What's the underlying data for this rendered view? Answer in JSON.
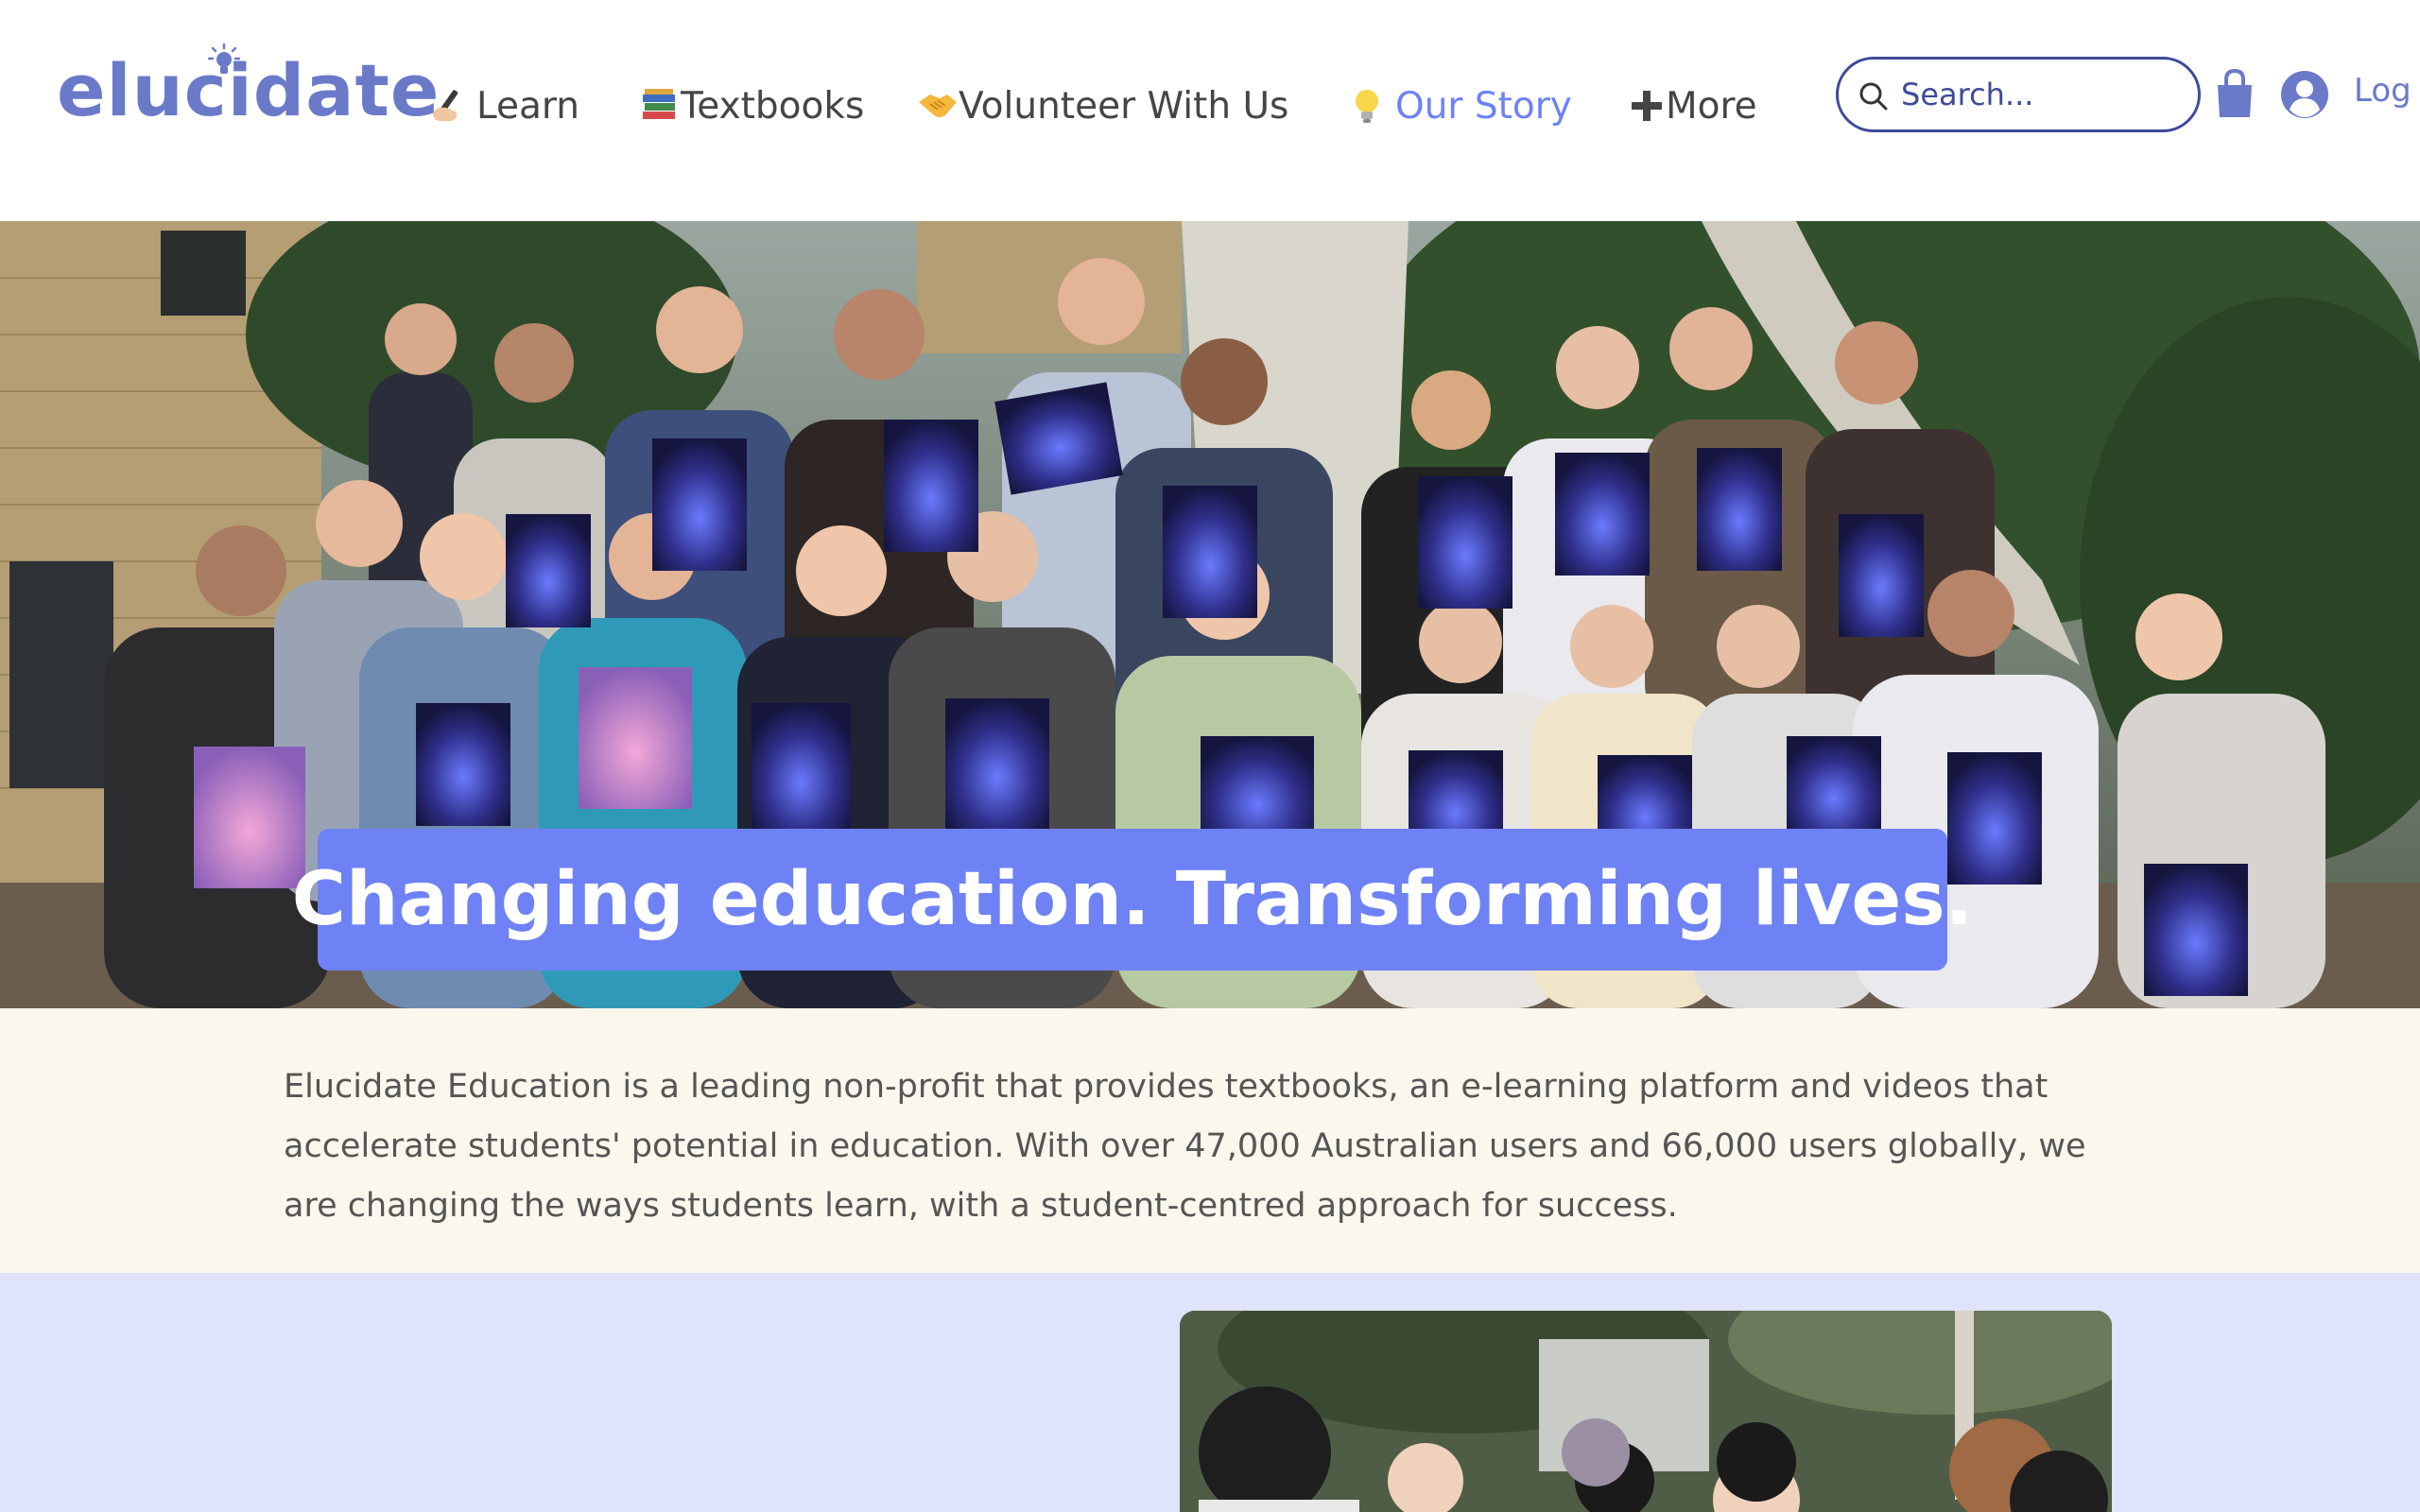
{
  "brand": {
    "name": "elucidate",
    "color": "#6b79c9",
    "accent": "#6e82f5"
  },
  "nav": {
    "items": [
      {
        "label": "Learn",
        "icon": "writing-hand-icon"
      },
      {
        "label": "Textbooks",
        "icon": "books-icon"
      },
      {
        "label": "Volunteer With Us",
        "icon": "handshake-icon"
      },
      {
        "label": "Our Story",
        "icon": "lightbulb-icon",
        "active": true
      },
      {
        "label": "More",
        "icon": "plus-icon"
      }
    ]
  },
  "search": {
    "placeholder": "Search..."
  },
  "account": {
    "login_label": "Log"
  },
  "hero": {
    "banner_text": "Changing education. Transforming lives.",
    "image": "group-of-students-holding-textbooks"
  },
  "intro": {
    "text": "Elucidate Education is a leading non-profit that provides textbooks, an e-learning platform and videos that accelerate students' potential in education. With over 47,000 Australian users and 66,000 users globally, we are changing the ways students learn, with a student-centred approach for success."
  },
  "lower": {
    "image": "students-studying-outdoors"
  }
}
